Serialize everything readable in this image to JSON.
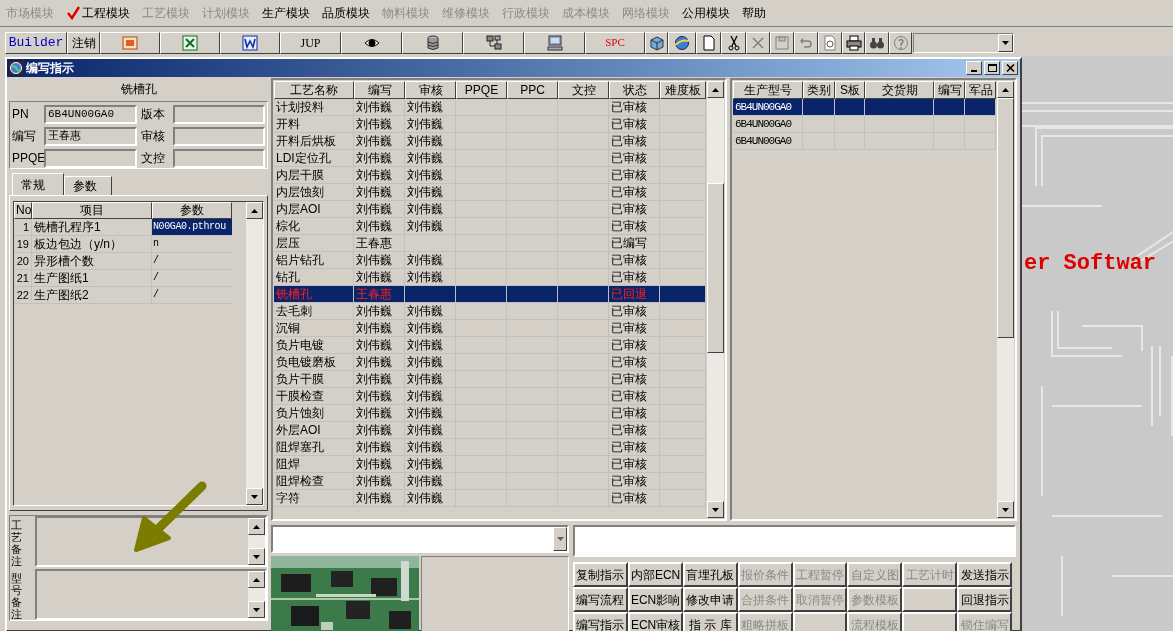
{
  "menu": [
    {
      "label": "市场模块",
      "disabled": true,
      "checked": false
    },
    {
      "label": "工程模块",
      "disabled": false,
      "checked": true
    },
    {
      "label": "工艺模块",
      "disabled": true,
      "checked": false
    },
    {
      "label": "计划模块",
      "disabled": true,
      "checked": false
    },
    {
      "label": "生产模块",
      "disabled": false,
      "checked": false
    },
    {
      "label": "品质模块",
      "disabled": false,
      "checked": false
    },
    {
      "label": "物料模块",
      "disabled": true,
      "checked": false
    },
    {
      "label": "维修模块",
      "disabled": true,
      "checked": false
    },
    {
      "label": "行政模块",
      "disabled": true,
      "checked": false
    },
    {
      "label": "成本模块",
      "disabled": true,
      "checked": false
    },
    {
      "label": "网络模块",
      "disabled": true,
      "checked": false
    },
    {
      "label": "公用模块",
      "disabled": false,
      "checked": false
    },
    {
      "label": "帮助",
      "disabled": false,
      "checked": false
    }
  ],
  "toolbar": {
    "builder": "Builder",
    "logout": "注销",
    "jup": "JUP",
    "spc": "SPC"
  },
  "window": {
    "title": "编写指示"
  },
  "left_panel": {
    "title": "铣槽孔",
    "fields": [
      {
        "label": "PN",
        "value": "6B4UN00GA0"
      },
      {
        "label": "版本"
      },
      {
        "label": "编写",
        "value": "王春惠"
      },
      {
        "label": "审核"
      },
      {
        "label": "PPQE"
      },
      {
        "label": "文控"
      }
    ],
    "tabs": [
      {
        "label": "常规",
        "selected": true
      },
      {
        "label": "参数",
        "selected": false
      }
    ],
    "grid": {
      "columns": [
        "No",
        "项目",
        "参数"
      ],
      "rows": [
        {
          "no": "1",
          "item": "铣槽孔程序1",
          "value": "N00GA0.pthrou",
          "selected": true
        },
        {
          "no": "19",
          "item": "板边包边（y/n）",
          "value": "n",
          "selected": false
        },
        {
          "no": "20",
          "item": "异形槽个数",
          "value": "/",
          "selected": false
        },
        {
          "no": "21",
          "item": "生产图纸1",
          "value": "/",
          "selected": false
        },
        {
          "no": "22",
          "item": "生产图纸2",
          "value": "/",
          "selected": false
        }
      ]
    },
    "notes": [
      {
        "label": "工艺备注"
      },
      {
        "label": "型号备注"
      }
    ]
  },
  "process_table": {
    "columns": [
      "工艺名称",
      "编写",
      "审核",
      "PPQE",
      "PPC",
      "文控",
      "状态",
      "难度板"
    ],
    "rows": [
      {
        "name": "计划投料",
        "writer": "刘伟巍",
        "reviewer": "刘伟巍",
        "status": "已审核",
        "selected": false,
        "returned": false
      },
      {
        "name": "开料",
        "writer": "刘伟巍",
        "reviewer": "刘伟巍",
        "status": "已审核",
        "selected": false,
        "returned": false
      },
      {
        "name": "开料后烘板",
        "writer": "刘伟巍",
        "reviewer": "刘伟巍",
        "status": "已审核",
        "selected": false,
        "returned": false
      },
      {
        "name": "LDI定位孔",
        "writer": "刘伟巍",
        "reviewer": "刘伟巍",
        "status": "已审核",
        "selected": false,
        "returned": false
      },
      {
        "name": "内层干膜",
        "writer": "刘伟巍",
        "reviewer": "刘伟巍",
        "status": "已审核",
        "selected": false,
        "returned": false
      },
      {
        "name": "内层蚀刻",
        "writer": "刘伟巍",
        "reviewer": "刘伟巍",
        "status": "已审核",
        "selected": false,
        "returned": false
      },
      {
        "name": "内层AOI",
        "writer": "刘伟巍",
        "reviewer": "刘伟巍",
        "status": "已审核",
        "selected": false,
        "returned": false
      },
      {
        "name": "棕化",
        "writer": "刘伟巍",
        "reviewer": "刘伟巍",
        "status": "已审核",
        "selected": false,
        "returned": false
      },
      {
        "name": "层压",
        "writer": "王春惠",
        "status": "已编写",
        "selected": false,
        "returned": false
      },
      {
        "name": "铝片钻孔",
        "writer": "刘伟巍",
        "reviewer": "刘伟巍",
        "status": "已审核",
        "selected": false,
        "returned": false
      },
      {
        "name": "钻孔",
        "writer": "刘伟巍",
        "reviewer": "刘伟巍",
        "status": "已审核",
        "selected": false,
        "returned": false
      },
      {
        "name": "铣槽孔",
        "writer": "王春惠",
        "status": "已回退",
        "selected": true,
        "returned": true
      },
      {
        "name": "去毛刺",
        "writer": "刘伟巍",
        "reviewer": "刘伟巍",
        "status": "已审核",
        "selected": false,
        "returned": false
      },
      {
        "name": "沉铜",
        "writer": "刘伟巍",
        "reviewer": "刘伟巍",
        "status": "已审核",
        "selected": false,
        "returned": false
      },
      {
        "name": "负片电镀",
        "writer": "刘伟巍",
        "reviewer": "刘伟巍",
        "status": "已审核",
        "selected": false,
        "returned": false
      },
      {
        "name": "负电镀磨板",
        "writer": "刘伟巍",
        "reviewer": "刘伟巍",
        "status": "已审核",
        "selected": false,
        "returned": false
      },
      {
        "name": "负片干膜",
        "writer": "刘伟巍",
        "reviewer": "刘伟巍",
        "status": "已审核",
        "selected": false,
        "returned": false
      },
      {
        "name": "干膜检查",
        "writer": "刘伟巍",
        "reviewer": "刘伟巍",
        "status": "已审核",
        "selected": false,
        "returned": false
      },
      {
        "name": "负片蚀刻",
        "writer": "刘伟巍",
        "reviewer": "刘伟巍",
        "status": "已审核",
        "selected": false,
        "returned": false
      },
      {
        "name": "外层AOI",
        "writer": "刘伟巍",
        "reviewer": "刘伟巍",
        "status": "已审核",
        "selected": false,
        "returned": false
      },
      {
        "name": "阻焊塞孔",
        "writer": "刘伟巍",
        "reviewer": "刘伟巍",
        "status": "已审核",
        "selected": false,
        "returned": false
      },
      {
        "name": "阻焊",
        "writer": "刘伟巍",
        "reviewer": "刘伟巍",
        "status": "已审核",
        "selected": false,
        "returned": false
      },
      {
        "name": "阻焊检查",
        "writer": "刘伟巍",
        "reviewer": "刘伟巍",
        "status": "已审核",
        "selected": false,
        "returned": false
      },
      {
        "name": "字符",
        "writer": "刘伟巍",
        "reviewer": "刘伟巍",
        "status": "已审核",
        "selected": false,
        "returned": false
      }
    ]
  },
  "model_table": {
    "columns": [
      "生产型号",
      "类别",
      "S板",
      "交货期",
      "编写",
      "军品"
    ],
    "rows": [
      {
        "model": "6B4UN00GA0",
        "selected": true
      },
      {
        "model": "6B4UN00GA0",
        "selected": false
      },
      {
        "model": "6B4UN00GA0",
        "selected": false
      }
    ]
  },
  "buttons": [
    [
      {
        "kind": "button",
        "label": "复制指示",
        "disabled": false
      },
      {
        "kind": "button",
        "label": "内部ECN",
        "disabled": false
      },
      {
        "kind": "button",
        "label": "盲埋孔板",
        "disabled": false
      },
      {
        "kind": "button",
        "label": "报价条件",
        "disabled": true
      },
      {
        "kind": "button",
        "label": "工程暂停",
        "disabled": true
      },
      {
        "kind": "button",
        "label": "自定义图",
        "disabled": true
      },
      {
        "kind": "button",
        "label": "工艺计时",
        "disabled": true
      },
      {
        "kind": "button",
        "label": "发送指示",
        "disabled": false
      }
    ],
    [
      {
        "kind": "button",
        "label": "编写流程",
        "disabled": false
      },
      {
        "kind": "button",
        "label": "ECN影响",
        "disabled": false
      },
      {
        "kind": "button",
        "label": "修改申请",
        "disabled": false
      },
      {
        "kind": "button",
        "label": "合拼条件",
        "disabled": true
      },
      {
        "kind": "button",
        "label": "取消暂停",
        "disabled": true
      },
      {
        "kind": "button",
        "label": "参数模板",
        "disabled": true
      },
      {
        "kind": "blank"
      },
      {
        "kind": "button",
        "label": "回退指示",
        "disabled": false
      }
    ],
    [
      {
        "kind": "button",
        "label": "编写指示",
        "disabled": false
      },
      {
        "kind": "button",
        "label": "ECN审核",
        "disabled": false
      },
      {
        "kind": "button",
        "label": "指 示 库",
        "disabled": false
      },
      {
        "kind": "button",
        "label": "粗略拼板",
        "disabled": true
      },
      {
        "kind": "blank"
      },
      {
        "kind": "button",
        "label": "流程模板",
        "disabled": true
      },
      {
        "kind": "blank"
      },
      {
        "kind": "button",
        "label": "锁住编写",
        "disabled": true
      }
    ]
  ],
  "background_text": "er Softwar"
}
